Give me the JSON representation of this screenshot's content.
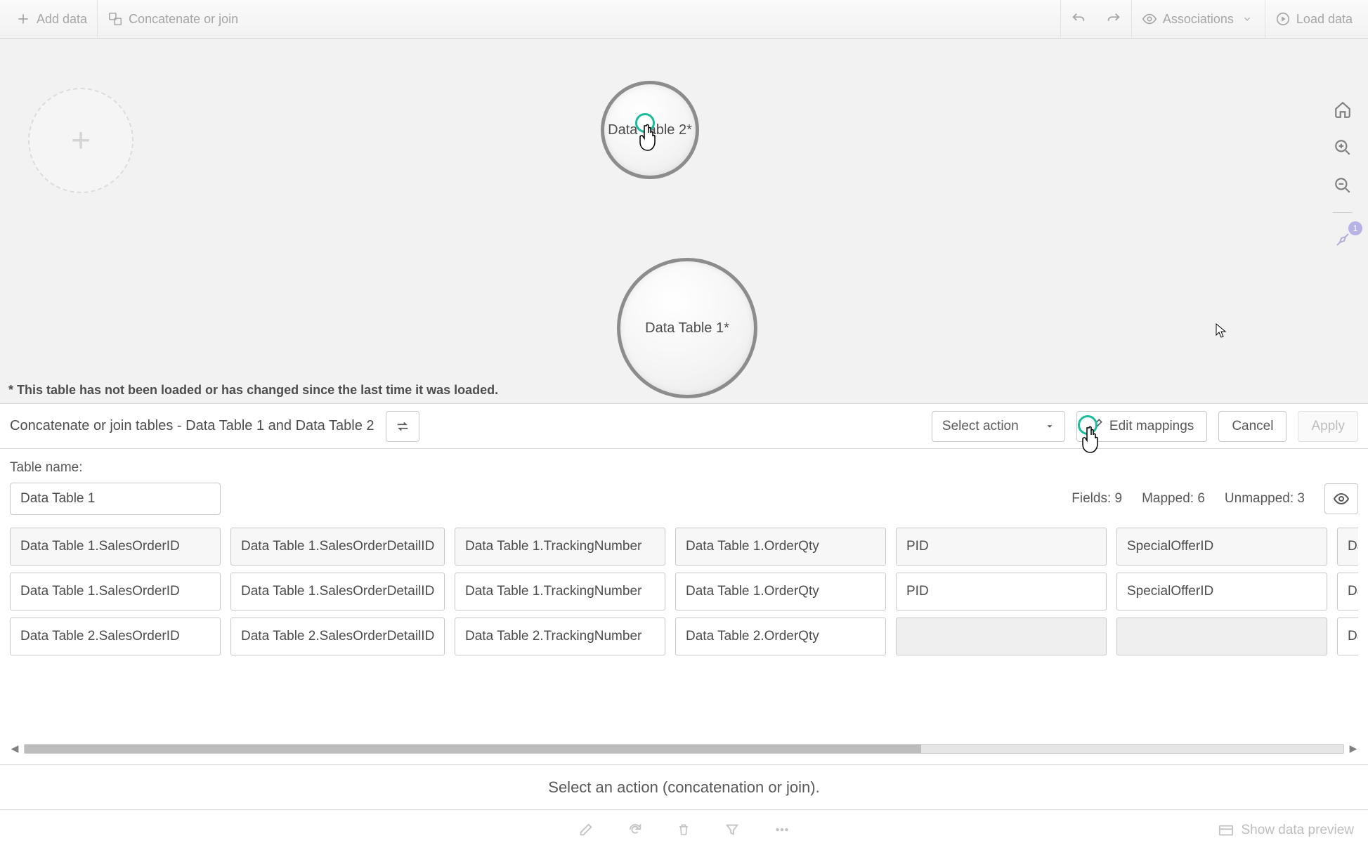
{
  "toolbar": {
    "add_data": "Add data",
    "concat": "Concatenate or join",
    "associations": "Associations",
    "load_data": "Load data"
  },
  "canvas": {
    "bubble1": "Data Table 2*",
    "bubble2": "Data Table 1*",
    "note": "* This table has not been loaded or has changed since the last time it was loaded.",
    "recommendations_badge": "1"
  },
  "panel": {
    "title": "Concatenate or join tables - Data Table 1 and Data Table 2",
    "select_action": "Select action",
    "edit_mappings": "Edit mappings",
    "cancel": "Cancel",
    "apply": "Apply"
  },
  "config": {
    "table_name_label": "Table name:",
    "table_name_value": "Data Table 1",
    "fields_label": "Fields:",
    "fields_value": "9",
    "mapped_label": "Mapped:",
    "mapped_value": "6",
    "unmapped_label": "Unmapped:",
    "unmapped_value": "3"
  },
  "columns": [
    {
      "header": "Data Table 1.SalesOrderID",
      "r1": "Data Table 1.SalesOrderID",
      "r2": "Data Table 2.SalesOrderID"
    },
    {
      "header": "Data Table 1.SalesOrderDetailID",
      "r1": "Data Table 1.SalesOrderDetailID",
      "r2": "Data Table 2.SalesOrderDetailID"
    },
    {
      "header": "Data Table 1.TrackingNumber",
      "r1": "Data Table 1.TrackingNumber",
      "r2": "Data Table 2.TrackingNumber"
    },
    {
      "header": "Data Table 1.OrderQty",
      "r1": "Data Table 1.OrderQty",
      "r2": "Data Table 2.OrderQty"
    },
    {
      "header": "PID",
      "r1": "PID",
      "r2": ""
    },
    {
      "header": "SpecialOfferID",
      "r1": "SpecialOfferID",
      "r2": ""
    },
    {
      "header": "Data Ta",
      "r1": "Data Ta",
      "r2": "Data Ta"
    }
  ],
  "hint": "Select an action (concatenation or join).",
  "bottom": {
    "preview": "Show data preview"
  }
}
